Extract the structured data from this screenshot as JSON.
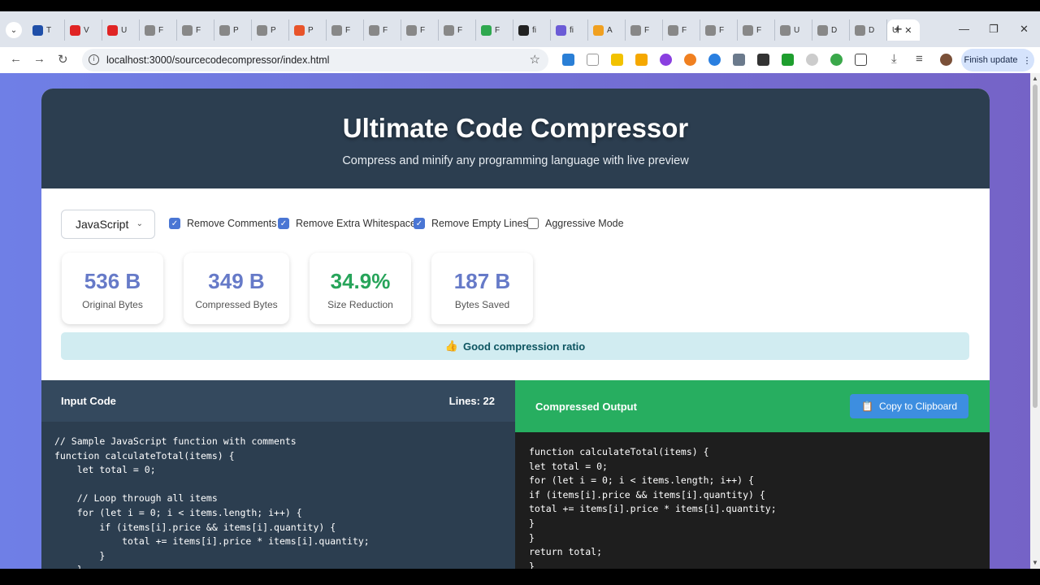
{
  "browser": {
    "tabs": [
      {
        "letter": "T",
        "color": "#1f4fa8"
      },
      {
        "letter": "V",
        "color": "#e02424"
      },
      {
        "letter": "U",
        "color": "#e02424"
      },
      {
        "letter": "F",
        "color": "#888888"
      },
      {
        "letter": "F",
        "color": "#888888"
      },
      {
        "letter": "P",
        "color": "#888888"
      },
      {
        "letter": "P",
        "color": "#888888"
      },
      {
        "letter": "P",
        "color": "#e8542a"
      },
      {
        "letter": "F",
        "color": "#888888"
      },
      {
        "letter": "F",
        "color": "#888888"
      },
      {
        "letter": "F",
        "color": "#888888"
      },
      {
        "letter": "F",
        "color": "#888888"
      },
      {
        "letter": "F",
        "color": "#2fa84f"
      },
      {
        "letter": "fi",
        "color": "#222222"
      },
      {
        "letter": "fi",
        "color": "#6b5bd6"
      },
      {
        "letter": "A",
        "color": "#f0a020"
      },
      {
        "letter": "F",
        "color": "#888888"
      },
      {
        "letter": "F",
        "color": "#888888"
      },
      {
        "letter": "F",
        "color": "#888888"
      },
      {
        "letter": "F",
        "color": "#888888"
      },
      {
        "letter": "U",
        "color": "#888888"
      },
      {
        "letter": "D",
        "color": "#888888"
      },
      {
        "letter": "D",
        "color": "#888888"
      }
    ],
    "active_tab": "U",
    "url": "localhost:3000/sourcecodecompressor/index.html",
    "finish_update": "Finish update"
  },
  "header": {
    "title": "Ultimate Code Compressor",
    "subtitle": "Compress and minify any programming language with live preview"
  },
  "controls": {
    "language": "JavaScript",
    "options": [
      {
        "label": "Remove Comments",
        "checked": true
      },
      {
        "label": "Remove Extra Whitespace",
        "checked": true
      },
      {
        "label": "Remove Empty Lines",
        "checked": true
      },
      {
        "label": "Aggressive Mode",
        "checked": false
      }
    ]
  },
  "stats": [
    {
      "value": "536 B",
      "label": "Original Bytes"
    },
    {
      "value": "349 B",
      "label": "Compressed Bytes"
    },
    {
      "value": "34.9%",
      "label": "Size Reduction"
    },
    {
      "value": "187 B",
      "label": "Bytes Saved"
    }
  ],
  "ratio": {
    "icon": "👍",
    "text": "Good compression ratio"
  },
  "input": {
    "title": "Input Code",
    "lines": "Lines: 22",
    "code": "// Sample JavaScript function with comments\nfunction calculateTotal(items) {\n    let total = 0;\n\n    // Loop through all items\n    for (let i = 0; i < items.length; i++) {\n        if (items[i].price && items[i].quantity) {\n            total += items[i].price * items[i].quantity;\n        }\n    }"
  },
  "output": {
    "title": "Compressed Output",
    "copy_label": "Copy to Clipboard",
    "code": "function calculateTotal(items) {\nlet total = 0;\nfor (let i = 0; i < items.length; i++) {\nif (items[i].price && items[i].quantity) {\ntotal += items[i].price * items[i].quantity;\n}\n}\nreturn total;\n}"
  }
}
